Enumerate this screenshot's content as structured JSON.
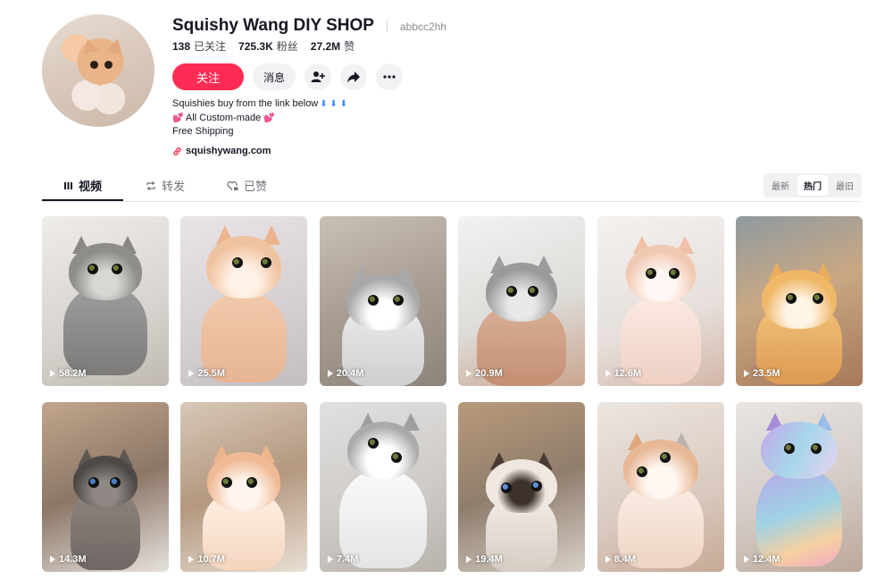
{
  "profile": {
    "name": "Squishy Wang DIY SHOP",
    "unique_id": "abbcc2hh",
    "stats": [
      {
        "value": "138",
        "label": "已关注"
      },
      {
        "value": "725.3K",
        "label": "粉丝"
      },
      {
        "value": "27.2M",
        "label": "赞"
      }
    ],
    "follow_label": "关注",
    "message_label": "消息",
    "bio_line1": "Squishies buy from the link below",
    "bio_arrows": "⬇ ⬇ ⬇",
    "bio_line2": "All Custom-made",
    "bio_heart": "💕",
    "bio_line3": "Free Shipping",
    "link": "squishywang.com"
  },
  "tabs": [
    {
      "label": "视频",
      "icon": "grid-bars-icon"
    },
    {
      "label": "转发",
      "icon": "repost-icon"
    },
    {
      "label": "已赞",
      "icon": "heart-lock-icon"
    }
  ],
  "sort": [
    "最新",
    "热门",
    "最旧"
  ],
  "videos": [
    {
      "views": "58.2M"
    },
    {
      "views": "25.5M"
    },
    {
      "views": "20.4M"
    },
    {
      "views": "20.9M"
    },
    {
      "views": "12.6M"
    },
    {
      "views": "23.5M"
    },
    {
      "views": "14.3M"
    },
    {
      "views": "10.7M"
    },
    {
      "views": "7.4M"
    },
    {
      "views": "19.4M"
    },
    {
      "views": "8.4M"
    },
    {
      "views": "12.4M"
    }
  ],
  "colors": {
    "accent": "#fe2c55",
    "text": "#161823",
    "muted": "#8a8b91"
  }
}
